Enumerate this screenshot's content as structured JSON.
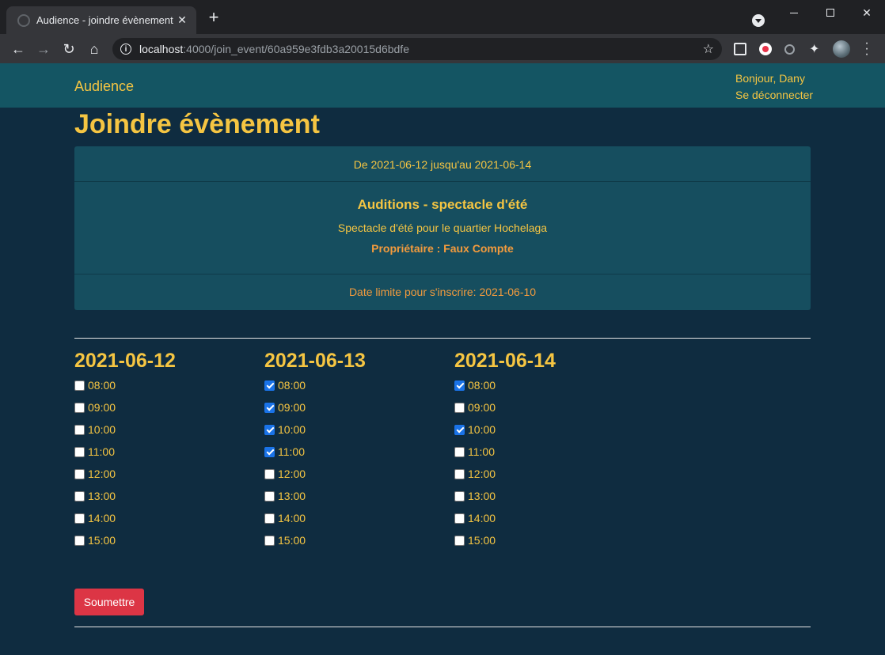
{
  "browser": {
    "tab_title": "Audience - joindre évènement",
    "url_host": "localhost",
    "url_rest": ":4000/join_event/60a959e3fdb3a20015d6bdfe"
  },
  "navbar": {
    "brand": "Audience",
    "greeting": "Bonjour, Dany",
    "logout": "Se déconnecter"
  },
  "page_title": "Joindre évènement",
  "event": {
    "date_range": "De 2021-06-12 jusqu'au 2021-06-14",
    "title": "Auditions - spectacle d'été",
    "description": "Spectacle d'été pour le quartier Hochelaga",
    "owner": "Propriétaire : Faux Compte",
    "deadline": "Date limite pour s'inscrire: 2021-06-10"
  },
  "days": [
    {
      "date": "2021-06-12",
      "slots": [
        {
          "time": "08:00",
          "checked": false
        },
        {
          "time": "09:00",
          "checked": false
        },
        {
          "time": "10:00",
          "checked": false
        },
        {
          "time": "11:00",
          "checked": false
        },
        {
          "time": "12:00",
          "checked": false
        },
        {
          "time": "13:00",
          "checked": false
        },
        {
          "time": "14:00",
          "checked": false
        },
        {
          "time": "15:00",
          "checked": false
        }
      ]
    },
    {
      "date": "2021-06-13",
      "slots": [
        {
          "time": "08:00",
          "checked": true
        },
        {
          "time": "09:00",
          "checked": true
        },
        {
          "time": "10:00",
          "checked": true
        },
        {
          "time": "11:00",
          "checked": true
        },
        {
          "time": "12:00",
          "checked": false
        },
        {
          "time": "13:00",
          "checked": false
        },
        {
          "time": "14:00",
          "checked": false
        },
        {
          "time": "15:00",
          "checked": false
        }
      ]
    },
    {
      "date": "2021-06-14",
      "slots": [
        {
          "time": "08:00",
          "checked": true
        },
        {
          "time": "09:00",
          "checked": false
        },
        {
          "time": "10:00",
          "checked": true
        },
        {
          "time": "11:00",
          "checked": false
        },
        {
          "time": "12:00",
          "checked": false
        },
        {
          "time": "13:00",
          "checked": false
        },
        {
          "time": "14:00",
          "checked": false
        },
        {
          "time": "15:00",
          "checked": false
        }
      ]
    }
  ],
  "submit_label": "Soumettre",
  "colors": {
    "accent": "#f5c542",
    "navbar": "#145563",
    "background": "#0f2c40",
    "card": "#164e5f",
    "submit": "#dc3545"
  }
}
